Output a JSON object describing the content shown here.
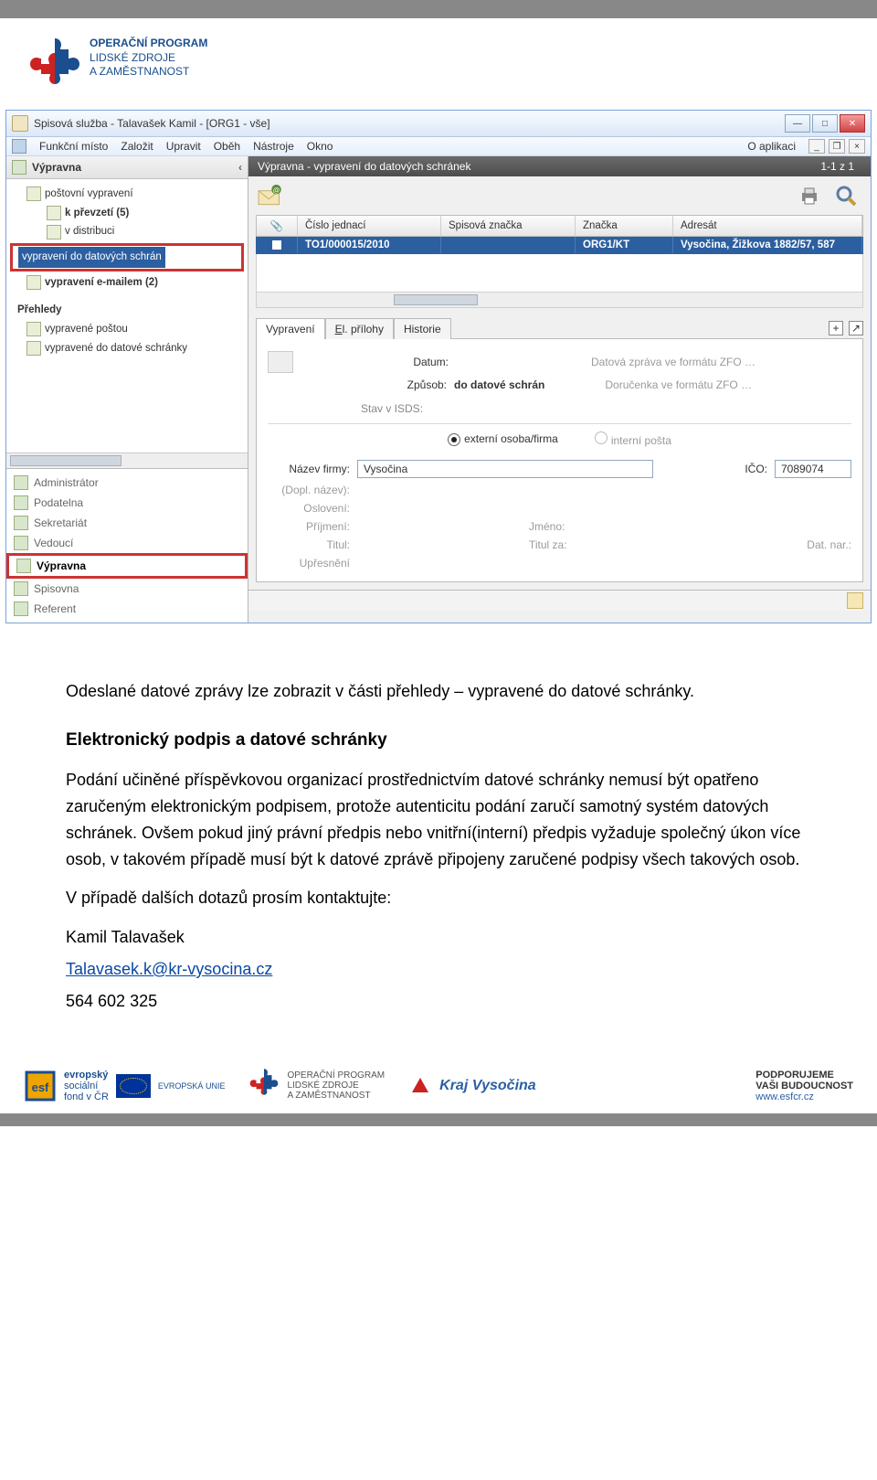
{
  "logo": {
    "line1": "OPERAČNÍ PROGRAM",
    "line2": "LIDSKÉ ZDROJE",
    "line3": "A ZAMĚSTNANOST"
  },
  "app": {
    "title": "Spisová služba - Talavašek Kamil - [ORG1 - vše]",
    "menu": [
      "Funkční místo",
      "Založit",
      "Upravit",
      "Oběh",
      "Nástroje",
      "Okno"
    ],
    "menu_right": "O aplikaci",
    "sidebar": {
      "pane_title": "Výpravna",
      "tree": {
        "group1_items": [
          "poštovní vypravení",
          "k převzetí (5)",
          "v distribuci"
        ],
        "hl_label": "vypravení do datových schrán",
        "after_hl": "vypravení e-mailem (2)",
        "group2_label": "Přehledy",
        "group2_items": [
          "vypravené poštou",
          "vypravené do datové schránky"
        ]
      },
      "roles": [
        "Administrátor",
        "Podatelna",
        "Sekretariát",
        "Vedoucí",
        "Výpravna",
        "Spisovna",
        "Referent"
      ],
      "role_hl_index": 4
    },
    "main": {
      "titlebar": "Výpravna - vypravení do datových schránek",
      "count": "1-1 z 1",
      "columns": [
        "",
        "Číslo jednací",
        "Spisová značka",
        "Značka",
        "Adresát"
      ],
      "row": {
        "cj": "TO1/000015/2010",
        "znacka": "ORG1/KT",
        "adresat": "Vysočina, Žižkova 1882/57, 587"
      },
      "tabs": [
        "Vypravení",
        "El. přílohy",
        "Historie"
      ],
      "form": {
        "datum_label": "Datum:",
        "zpusob_label": "Způsob:",
        "zpusob_value": "do datové schrán",
        "zfo1": "Datová zpráva ve formátu ZFO …",
        "zfo2": "Doručenka ve formátu ZFO …",
        "stav_label": "Stav v ISDS:",
        "radio_ext": "externí osoba/firma",
        "radio_int": "interní pošta",
        "nazev_label": "Název firmy:",
        "nazev_value": "Vysočina",
        "ico_label": "IČO:",
        "ico_value": "7089074",
        "dopl_label": "(Dopl. název):",
        "osloveni_label": "Oslovení:",
        "prijmeni_label": "Příjmení:",
        "jmeno_label": "Jméno:",
        "titul_label": "Titul:",
        "titulza_label": "Titul za:",
        "datnar_label": "Dat. nar.:",
        "upresneni_label": "Upřesnění"
      }
    }
  },
  "doc": {
    "p1": "Odeslané datové zprávy lze zobrazit v části přehledy – vypravené do datové schránky.",
    "h1": "Elektronický podpis a datové schránky",
    "p2": "Podání učiněné příspěvkovou organizací prostřednictvím datové schránky nemusí být opatřeno zaručeným elektronickým podpisem, protože autenticitu podání zaručí samotný systém datových schránek. Ovšem pokud jiný právní předpis nebo vnitřní(interní) předpis vyžaduje společný úkon více osob, v takovém případě musí být k datové zprávě připojeny zaručené podpisy všech takových osob.",
    "p3": "V případě dalších dotazů prosím kontaktujte:",
    "contact_name": "Kamil Talavašek",
    "email": "Talavasek.k@kr-vysocina.cz",
    "phone": "564 602 325"
  },
  "footer": {
    "esf_t1": "evropský",
    "esf_t2": "sociální",
    "esf_t3": "fond v ČR",
    "eu": "EVROPSKÁ UNIE",
    "op1": "OPERAČNÍ PROGRAM",
    "op2": "LIDSKÉ ZDROJE",
    "op3": "A ZAMĚSTNANOST",
    "kraj": "Kraj Vysočina",
    "sup1": "PODPORUJEME",
    "sup2": "VAŠI BUDOUCNOST",
    "sup3": "www.esfcr.cz"
  }
}
